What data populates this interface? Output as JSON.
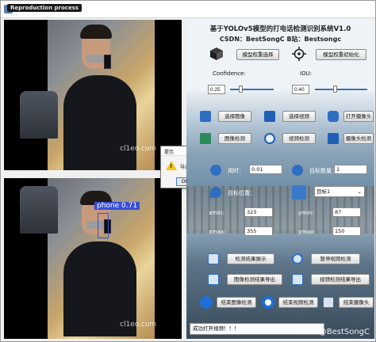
{
  "window": {
    "title": "",
    "overlay_label": "Reproduction process"
  },
  "video": {
    "watermark_top": "cl1eo.com",
    "watermark_bottom": "cl1eo.com",
    "detection_label": "phone  0.71"
  },
  "message_box": {
    "title": "提示",
    "close": "×",
    "text": "导出成功!",
    "ok": "OK"
  },
  "panel": {
    "title": "基于YOLOv5模型的打电话检测识别系统V1.0",
    "subtitle": "CSDN：BestSongC  B站：Bestsongc",
    "model_buttons": {
      "select_weights": "模型权重选择",
      "init_weights": "模型权重初始化"
    },
    "confidence": {
      "label": "Confidence:",
      "value": "0.25",
      "level": 0.25
    },
    "iou": {
      "label": "IOU:",
      "value": "0.40",
      "level": 0.4
    },
    "media_buttons": {
      "select_image": "选择图像",
      "select_video": "选择视频",
      "open_camera": "打开摄像头",
      "detect_image": "图像检测",
      "detect_video": "视频检测",
      "detect_camera": "摄像头检测"
    },
    "stats": {
      "time_label": "用时：",
      "time_value": "0.01",
      "count_label": "目标数量：",
      "count_value": "1",
      "position_label": "目标位置：",
      "target_select": "目标1",
      "xmin_label": "xmin:",
      "xmin_value": "323",
      "ymin_label": "ymin:",
      "ymin_value": "87",
      "xmax_label": "xmax:",
      "xmax_value": "355",
      "ymax_label": "ymax:",
      "ymax_value": "150"
    },
    "action_buttons": {
      "show_results": "检测结果展示",
      "pause_video": "暂停视频检测",
      "export_image": "图像检测结果导出",
      "export_video": "视频检测结果导出",
      "end_image": "结束图像检测",
      "end_video": "结束视频检测",
      "end_camera": "结束摄像头"
    },
    "status": "成功打开视频！！！",
    "watermark": "CSDN @BestSongC"
  },
  "colors": {
    "accent_blue": "#3a6fb0",
    "detection_box": "#3a4fd6",
    "warning_yellow": "#f5c518"
  }
}
